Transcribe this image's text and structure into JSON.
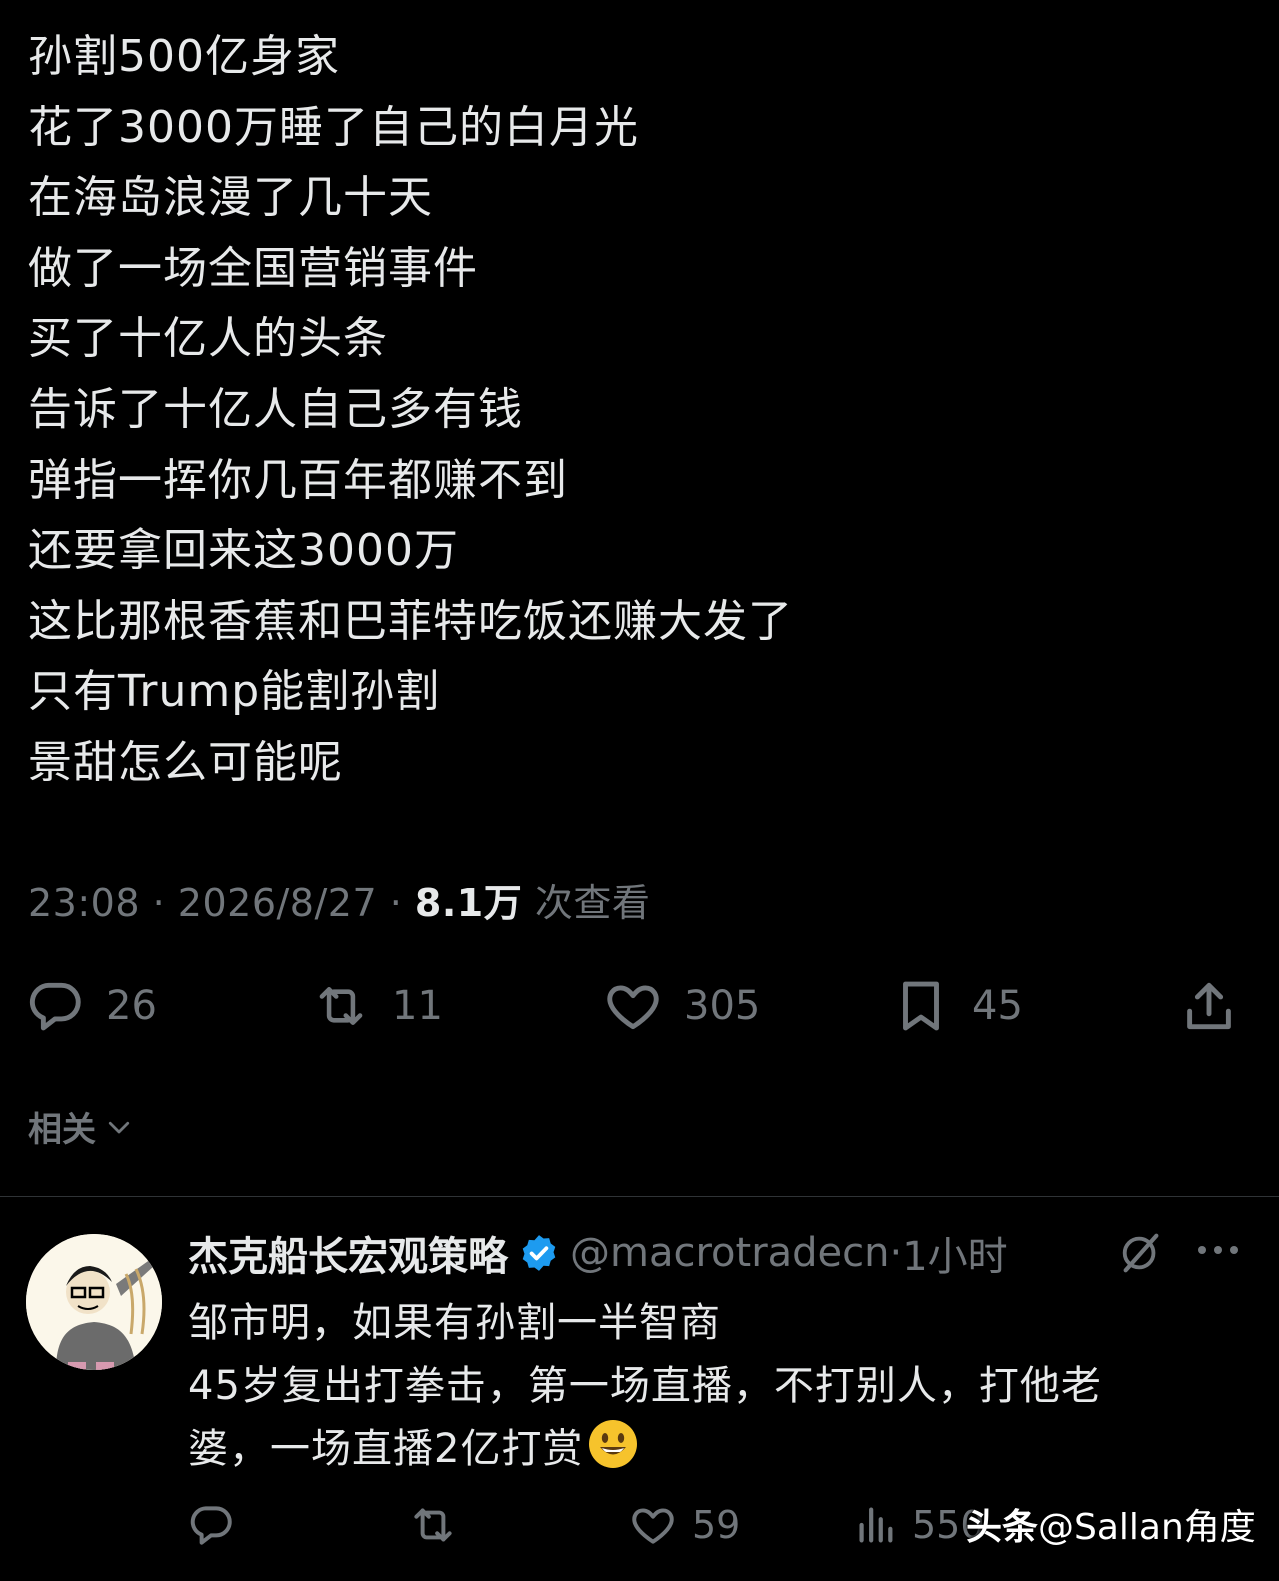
{
  "tweet": {
    "lines": [
      "孙割500亿身家",
      "花了3000万睡了自己的白月光",
      "在海岛浪漫了几十天",
      "做了一场全国营销事件",
      "买了十亿人的头条",
      "告诉了十亿人自己多有钱",
      "弹指一挥你几百年都赚不到",
      "还要拿回来这3000万",
      "这比那根香蕉和巴菲特吃饭还赚大发了",
      "只有Trump能割孙割",
      "景甜怎么可能呢"
    ],
    "time": "23:08",
    "dot": "·",
    "date": "2026/8/27",
    "views": "8.1万",
    "views_label": " 次查看"
  },
  "actions": {
    "reply": {
      "icon": "reply-icon",
      "count": "26"
    },
    "retweet": {
      "icon": "retweet-icon",
      "count": "11"
    },
    "like": {
      "icon": "heart-icon",
      "count": "305"
    },
    "bookmark": {
      "icon": "bookmark-icon",
      "count": "45"
    },
    "share": {
      "icon": "share-icon"
    }
  },
  "related": {
    "label": "相关",
    "icon": "chevron-down-icon"
  },
  "reply": {
    "name": "杰克船长宏观策略",
    "handle": "@macrotradecn",
    "dot": "·",
    "time": "1小时",
    "lines": [
      "邹市明，如果有孙割一半智商",
      "45岁复出打拳击，第一场直播，不打别人，打他老",
      "婆，一场直播2亿打赏"
    ],
    "actions": {
      "reply": {
        "icon": "reply-icon"
      },
      "retweet": {
        "icon": "retweet-icon"
      },
      "like": {
        "icon": "heart-icon",
        "count": "59"
      },
      "views": {
        "icon": "views-chart-icon",
        "count": "550"
      }
    }
  },
  "watermark": {
    "brand": "头条",
    "text": "@Sallan角度"
  },
  "colors": {
    "background": "#000000",
    "text": "#e7e9ea",
    "muted": "#71767b",
    "verified": "#1d9bf0"
  }
}
